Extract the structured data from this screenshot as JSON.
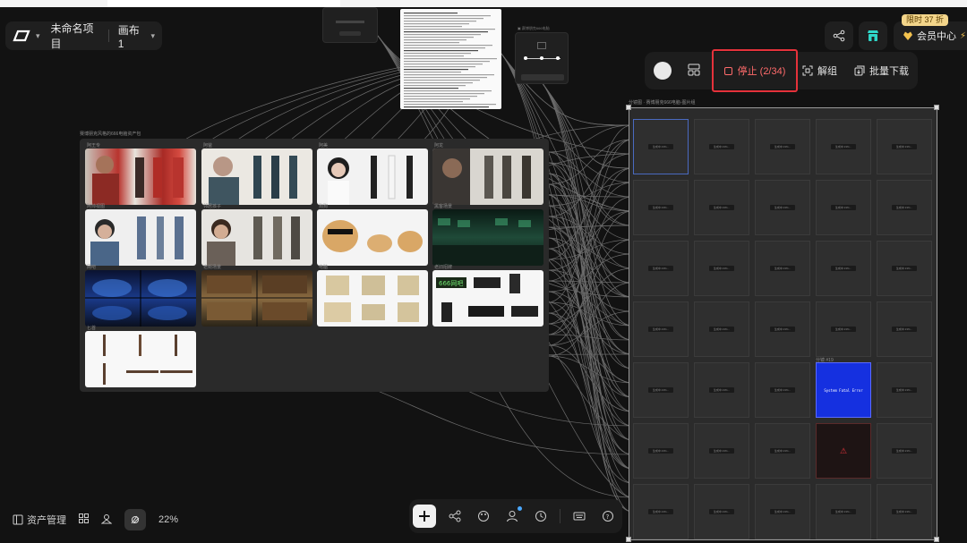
{
  "project": {
    "name": "未命名项目",
    "canvas": "画布 1"
  },
  "topbar": {
    "promo": "限时 37 折",
    "member": "会员中心"
  },
  "float_toolbar": {
    "stop_label": "停止 (2/34)",
    "ungroup_label": "解组",
    "download_label": "批量下载"
  },
  "bottom_left": {
    "assets_label": "资产管理",
    "zoom": "22%"
  },
  "asset_group": {
    "title": "赛博朋克风格的666电脑资产包",
    "thumbs": [
      {
        "caption": "阿王专"
      },
      {
        "caption": "阿爸"
      },
      {
        "caption": "阿美"
      },
      {
        "caption": "阿龙"
      },
      {
        "caption": "阿帅视图"
      },
      {
        "caption": "邻居孩子"
      },
      {
        "caption": "狗狗"
      },
      {
        "caption": "黑客场景"
      },
      {
        "caption": "网吧"
      },
      {
        "caption": "老街场景"
      },
      {
        "caption": "电脑"
      },
      {
        "caption": "老旧招牌"
      },
      {
        "caption": "匕首"
      }
    ]
  },
  "storyboard": {
    "title": "分镜图 · 赛博朋克666电脑-图片组",
    "cell_text": "生成中 23%...",
    "special_title": "分镜 #19",
    "error_screen": "System Fatal Error"
  },
  "colors": {
    "accent_red": "#e5323b",
    "canvas_bg": "#121212",
    "promo_bg": "#f3d58a"
  }
}
